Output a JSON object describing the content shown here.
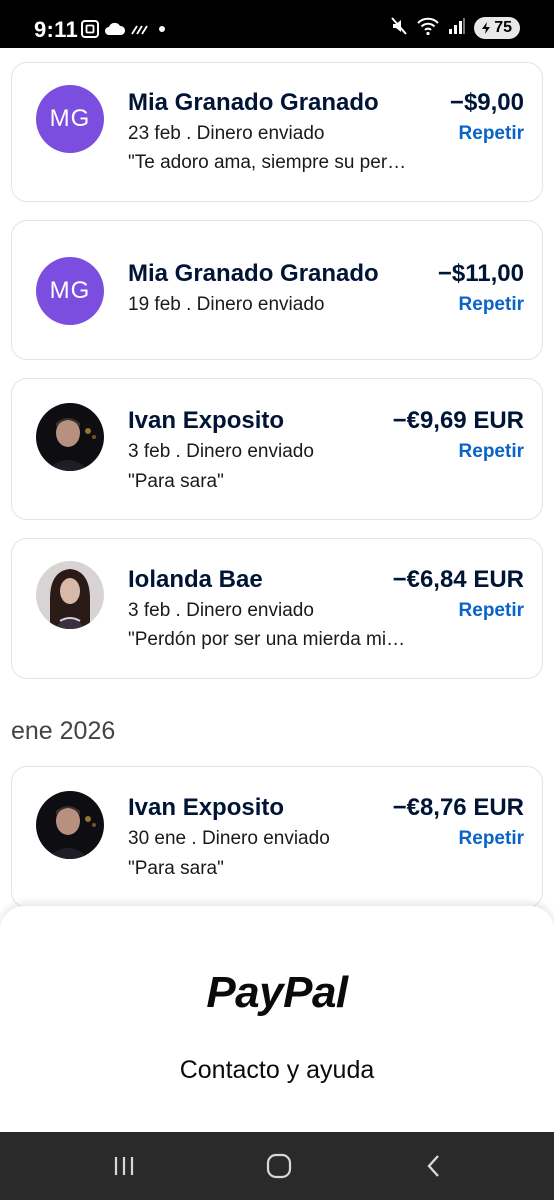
{
  "status_bar": {
    "time": "9:11",
    "battery": "75",
    "icons": [
      "screenshot-icon",
      "cloud-icon",
      "data-saver-icon",
      "dot-icon",
      "mute-icon",
      "wifi-icon",
      "signal-icon",
      "battery-icon"
    ]
  },
  "transactions": [
    {
      "name": "Mia Granado Granado",
      "initials": "MG",
      "date_type": "23 feb . Dinero enviado",
      "note": "\"Te adoro ama, siempre su per…",
      "amount": "−$9,00",
      "repeat": "Repetir"
    },
    {
      "name": "Mia Granado Granado",
      "initials": "MG",
      "date_type": "19 feb . Dinero enviado",
      "amount": "−$11,00",
      "repeat": "Repetir"
    },
    {
      "name": "Ivan Exposito",
      "date_type": "3 feb . Dinero enviado",
      "note": "\"Para sara\"",
      "amount": "−€9,69 EUR",
      "repeat": "Repetir"
    },
    {
      "name": "Iolanda Bae",
      "date_type": "3 feb . Dinero enviado",
      "note": "\"Perdón por ser una mierda mi…",
      "amount": "−€6,84 EUR",
      "repeat": "Repetir"
    }
  ],
  "section_jan": {
    "heading": "ene 2026",
    "transaction": {
      "name": "Ivan Exposito",
      "date_type": "30 ene . Dinero enviado",
      "note": "\"Para sara\"",
      "amount": "−€8,76 EUR",
      "repeat": "Repetir"
    }
  },
  "footer": {
    "logo": "PayPal",
    "help": "Contacto y ayuda"
  },
  "colors": {
    "initials_avatar": "#7b4ee0",
    "link": "#0a63c7",
    "text_dark": "#001435"
  },
  "nav": [
    "recents-icon",
    "home-icon",
    "back-icon"
  ]
}
